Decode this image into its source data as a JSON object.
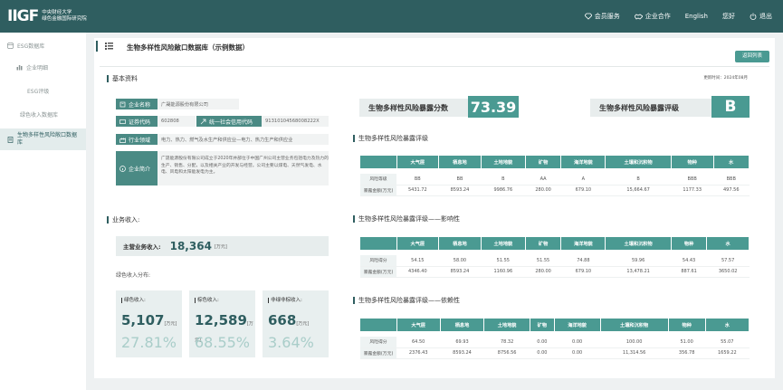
{
  "header": {
    "logo_mark": "IIGF",
    "logo_line1": "中央财经大学",
    "logo_line2": "绿色金融国际研究院",
    "nav": [
      {
        "icon": "diamond-icon",
        "label": "会员服务"
      },
      {
        "icon": "handshake-icon",
        "label": "企业合作"
      },
      {
        "icon": "",
        "label": "English"
      },
      {
        "icon": "",
        "label": "您好"
      },
      {
        "icon": "power-icon",
        "label": "退出"
      }
    ]
  },
  "sidebar": {
    "items": [
      {
        "label": "ESG数据库",
        "icon": "database-icon"
      },
      {
        "label": "企业明细",
        "icon": "bar-chart-icon"
      },
      {
        "label": "ESG评级",
        "icon": ""
      },
      {
        "label": "绿色收入数据库",
        "icon": ""
      },
      {
        "label": "生物多样性风险敞口数据库",
        "icon": "document-icon"
      }
    ]
  },
  "page": {
    "title": "生物多样性风险敞口数据库（示例数据）",
    "back_button": "返回列表",
    "update_time": "更新时间：2024年08月"
  },
  "basic": {
    "section_title": "基本资料",
    "company_name_label": "企业名称",
    "company_name": "广晟能源股份有限公司",
    "stock_code_label": "证券代码",
    "stock_code": "602808",
    "credit_code_label": "统一社会信用代码",
    "credit_code": "91310104568008222X",
    "industry_label": "行业领域",
    "industry": "电力、热力、燃气及水生产和供应业—电力、热力生产和供应业",
    "intro_label": "企业简介",
    "intro": "广晟能源股份有限公司成立于2020年并部位于中国广州公司主营业务包括电力及热力的生产、销售、分配，以及相关产业的开发与经营。公司主要以煤电、天然气发电、水电、风电和太阳能发电为主。"
  },
  "income": {
    "section_title": "业务收入:",
    "main_label": "主营业务收入:",
    "main_value": "18,364",
    "main_unit": "[万元]",
    "green_title": "绿色收入分布:",
    "cards": [
      {
        "label": "绿色收入:",
        "value": "5,107",
        "unit": "[万元]",
        "pct": "27.81%"
      },
      {
        "label": "棕色收入:",
        "value": "12,589",
        "unit": "[万元]",
        "pct": "68.55%"
      },
      {
        "label": "非绿非棕收入:",
        "value": "668",
        "unit": "[万元]",
        "pct": "3.64%"
      }
    ]
  },
  "scores": {
    "score_label": "生物多样性风险暴露分数",
    "score_value": "73.39",
    "rating_label": "生物多样性风险暴露评级",
    "rating_value": "B"
  },
  "tables": {
    "columns": [
      "大气层",
      "栖息地",
      "土地地貌",
      "矿物",
      "海洋地貌",
      "土壤和沉积物",
      "物种",
      "水"
    ],
    "rating": {
      "title": "生物多样性风险暴露评级",
      "rows": [
        {
          "name": "风险等级",
          "values": [
            "BB",
            "BB",
            "B",
            "AA",
            "A",
            "B",
            "BBB",
            "BBB"
          ]
        },
        {
          "name": "暴露金额(万元)",
          "values": [
            "5431.72",
            "8593.24",
            "9986.76",
            "280.00",
            "679.10",
            "15,664.67",
            "1177.33",
            "497.56"
          ]
        }
      ]
    },
    "impact": {
      "title": "生物多样性风险暴露评级——影响性",
      "rows": [
        {
          "name": "风险得分",
          "values": [
            "54.15",
            "58.00",
            "51.55",
            "51.55",
            "74.88",
            "59.96",
            "54.43",
            "57.57"
          ]
        },
        {
          "name": "暴露金额(万元)",
          "values": [
            "4346.40",
            "8593.24",
            "1160.96",
            "280.00",
            "679.10",
            "13,478.21",
            "887.61",
            "3650.02"
          ]
        }
      ]
    },
    "dependency": {
      "title": "生物多样性风险暴露评级——依赖性",
      "rows": [
        {
          "name": "风险得分",
          "values": [
            "64.50",
            "69.93",
            "78.32",
            "0.00",
            "0.00",
            "100.00",
            "51.00",
            "55.07"
          ]
        },
        {
          "name": "暴露金额(万元)",
          "values": [
            "2376.43",
            "8593.24",
            "8756.56",
            "0.00",
            "0.00",
            "11,314.56",
            "356.78",
            "1659.22"
          ]
        }
      ]
    }
  },
  "colors": {
    "primary": "#2f5e60",
    "accent": "#4a9a92",
    "light": "#e8efef"
  }
}
